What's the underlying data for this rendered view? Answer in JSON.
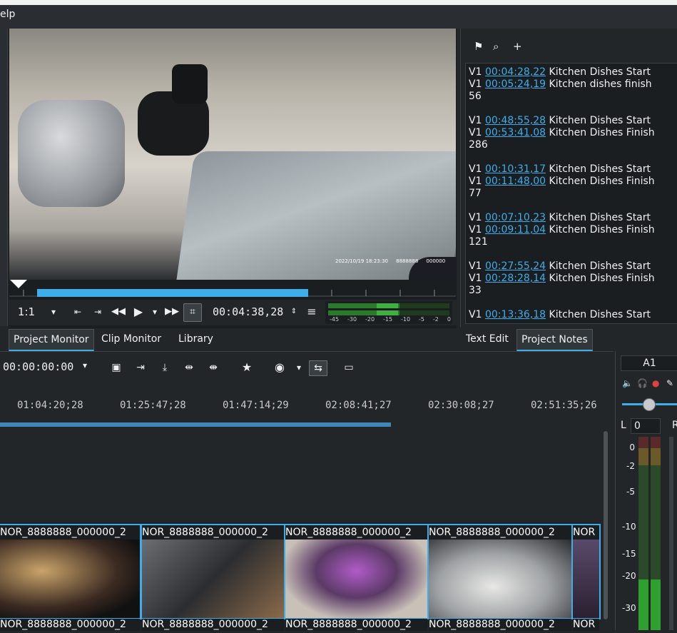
{
  "menubar": {
    "help_partial": "elp"
  },
  "monitor": {
    "overlay_text": "2022/10/19 18:23:30     8888888     000000",
    "zoom": "1:1",
    "timecode": "00:04:38,28",
    "vu_scale": [
      "-45",
      "-30",
      "-20",
      "-15",
      "-10",
      "-5",
      "-2",
      "0"
    ]
  },
  "tabs_left": [
    "Project Monitor",
    "Clip Monitor",
    "Library"
  ],
  "tabs_right": [
    "Text Edit",
    "Project Notes"
  ],
  "notes": {
    "lines": [
      {
        "prefix": "V1 ",
        "tc": "00:04:28,22",
        "text": " Kitchen Dishes Start"
      },
      {
        "prefix": "V1 ",
        "tc": "00:05:24,19",
        "text": " Kitchen dishes finish"
      },
      {
        "prefix": "56",
        "tc": "",
        "text": ""
      },
      {
        "prefix": "",
        "tc": "",
        "text": ""
      },
      {
        "prefix": "V1 ",
        "tc": "00:48:55,28",
        "text": " Kitchen Dishes Start"
      },
      {
        "prefix": "V1 ",
        "tc": "00:53:41,08",
        "text": " Kitchen Dishes Finish"
      },
      {
        "prefix": "286",
        "tc": "",
        "text": ""
      },
      {
        "prefix": "",
        "tc": "",
        "text": ""
      },
      {
        "prefix": "V1 ",
        "tc": "00:10:31,17",
        "text": " Kitchen Dishes Start"
      },
      {
        "prefix": "V1 ",
        "tc": "00:11:48,00",
        "text": " Kitchen Dishes Finish"
      },
      {
        "prefix": "77",
        "tc": "",
        "text": ""
      },
      {
        "prefix": "",
        "tc": "",
        "text": ""
      },
      {
        "prefix": "V1 ",
        "tc": "00:07:10,23",
        "text": " Kitchen Dishes Start"
      },
      {
        "prefix": "V1 ",
        "tc": "00:09:11,04",
        "text": " Kitchen Dishes Finish"
      },
      {
        "prefix": "121",
        "tc": "",
        "text": ""
      },
      {
        "prefix": "",
        "tc": "",
        "text": ""
      },
      {
        "prefix": "V1 ",
        "tc": "00:27:55,24",
        "text": " Kitchen Dishes Start"
      },
      {
        "prefix": "V1 ",
        "tc": "00:28:28,14",
        "text": " Kitchen Dishes Finish"
      },
      {
        "prefix": "33",
        "tc": "",
        "text": ""
      },
      {
        "prefix": "",
        "tc": "",
        "text": ""
      },
      {
        "prefix": "V1 ",
        "tc": "00:13:36,18",
        "text": " Kitchen Dishes Start"
      }
    ]
  },
  "timeline": {
    "timecode": "00:00:00:00",
    "ruler": [
      "01:04:20;28",
      "01:25:47;28",
      "01:47:14;29",
      "02:08:41;27",
      "02:30:08;27",
      "02:51:35;26"
    ],
    "clips": [
      "NOR_8888888_000000_2",
      "NOR_8888888_000000_2",
      "NOR_8888888_000000_2",
      "NOR_8888888_000000_2",
      "NOR"
    ],
    "clips_row2": [
      "NOR_8888888_000000_2",
      "NOR_8888888_000000_2",
      "NOR_8888888_000000_2",
      "NOR_8888888_000000_2",
      "NOR"
    ]
  },
  "mixer": {
    "track": "A1",
    "l": "L",
    "value": "0",
    "r": "R",
    "db": [
      "0",
      "-2",
      "-5",
      "-10",
      "-15",
      "-20",
      "-30"
    ]
  }
}
